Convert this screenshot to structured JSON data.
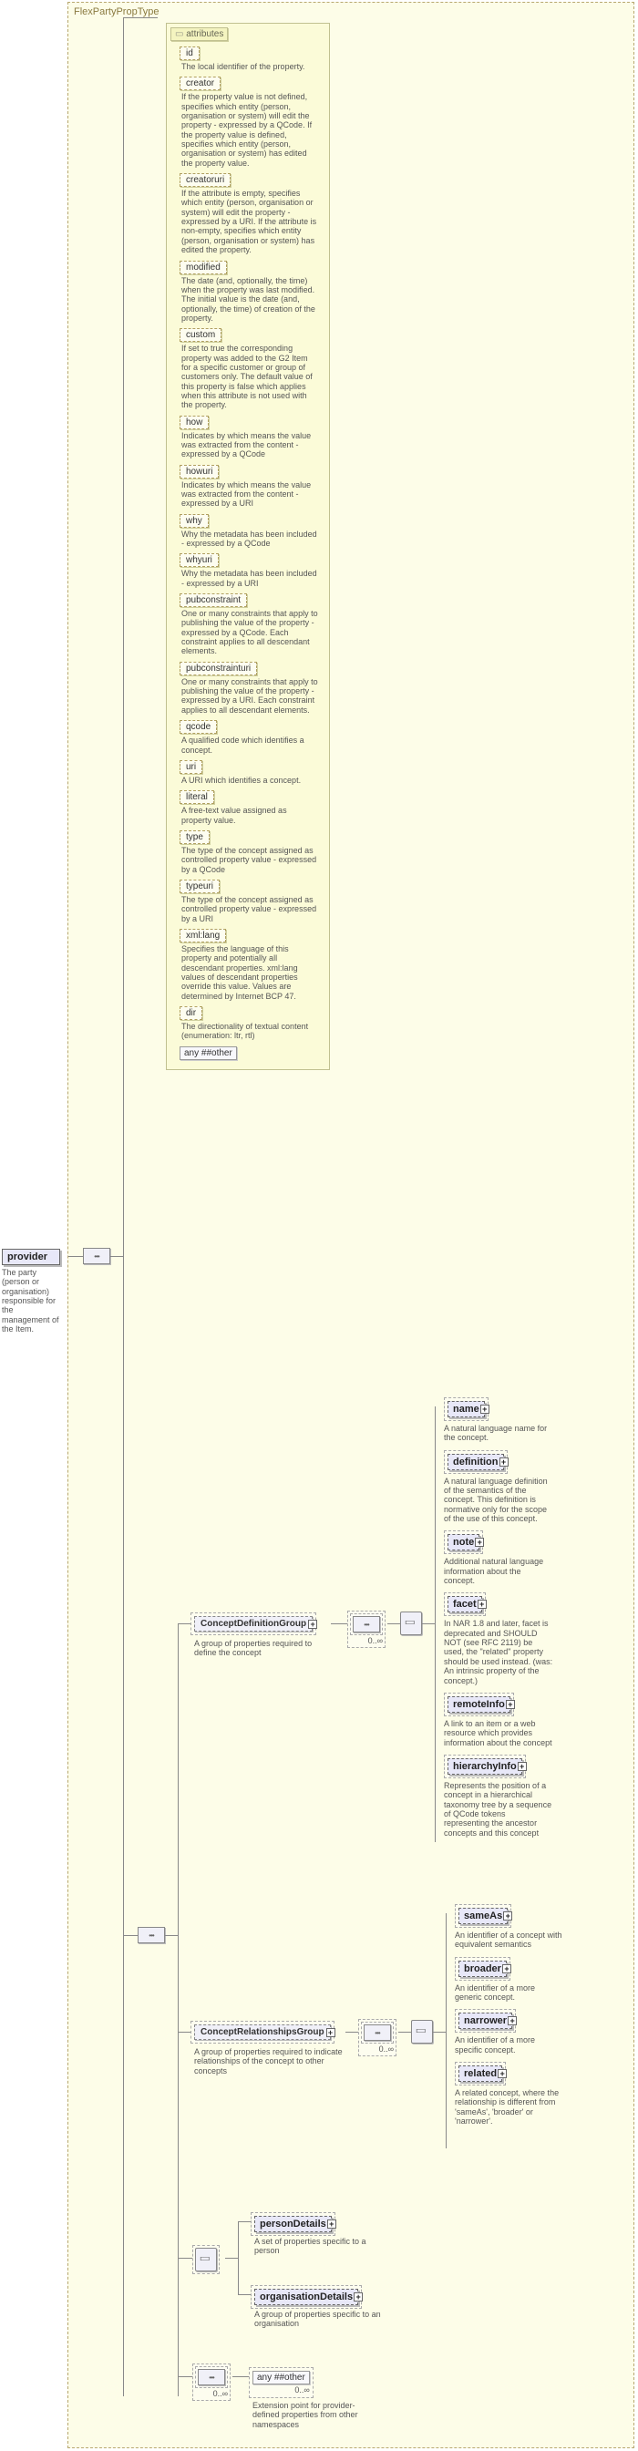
{
  "type_name": "FlexPartyPropType",
  "root": {
    "name": "provider",
    "desc": "The party (person or organisation) responsible for the management of the Item."
  },
  "attributes_label": "attributes",
  "attributes": [
    {
      "name": "id",
      "desc": "The local identifier of the property."
    },
    {
      "name": "creator",
      "desc": "If the property value is not defined, specifies which entity (person, organisation or system) will edit the property - expressed by a QCode. If the property value is defined, specifies which entity (person, organisation or system) has edited the property value."
    },
    {
      "name": "creatoruri",
      "desc": "If the attribute is empty, specifies which entity (person, organisation or system) will edit the property - expressed by a URI. If the attribute is non-empty, specifies which entity (person, organisation or system) has edited the property."
    },
    {
      "name": "modified",
      "desc": "The date (and, optionally, the time) when the property was last modified. The initial value is the date (and, optionally, the time) of creation of the property."
    },
    {
      "name": "custom",
      "desc": "If set to true the corresponding property was added to the G2 Item for a specific customer or group of customers only. The default value of this property is false which applies when this attribute is not used with the property."
    },
    {
      "name": "how",
      "desc": "Indicates by which means the value was extracted from the content - expressed by a QCode"
    },
    {
      "name": "howuri",
      "desc": "Indicates by which means the value was extracted from the content - expressed by a URI"
    },
    {
      "name": "why",
      "desc": "Why the metadata has been included - expressed by a QCode"
    },
    {
      "name": "whyuri",
      "desc": "Why the metadata has been included - expressed by a URI"
    },
    {
      "name": "pubconstraint",
      "desc": "One or many constraints that apply to publishing the value of the property - expressed by a QCode. Each constraint applies to all descendant elements."
    },
    {
      "name": "pubconstrainturi",
      "desc": "One or many constraints that apply to publishing the value of the property - expressed by a URI. Each constraint applies to all descendant elements."
    },
    {
      "name": "qcode",
      "desc": "A qualified code which identifies a concept."
    },
    {
      "name": "uri",
      "desc": "A URI which identifies a concept."
    },
    {
      "name": "literal",
      "desc": "A free-text value assigned as property value."
    },
    {
      "name": "type",
      "desc": "The type of the concept assigned as controlled property value - expressed by a QCode"
    },
    {
      "name": "typeuri",
      "desc": "The type of the concept assigned as controlled property value - expressed by a URI"
    },
    {
      "name": "xml:lang",
      "desc": "Specifies the language of this property and potentially all descendant properties. xml:lang values of descendant properties override this value. Values are determined by Internet BCP 47."
    },
    {
      "name": "dir",
      "desc": "The directionality of textual content (enumeration: ltr, rtl)"
    }
  ],
  "any_attr": "any ##other",
  "concept_def_group": {
    "name": "ConceptDefinitionGroup",
    "desc": "A group of properties required to define the concept"
  },
  "concept_def_children": [
    {
      "name": "name",
      "desc": "A natural language name for the concept."
    },
    {
      "name": "definition",
      "desc": "A natural language definition of the semantics of the concept. This definition is normative only for the scope of the use of this concept."
    },
    {
      "name": "note",
      "desc": "Additional natural language information about the concept."
    },
    {
      "name": "facet",
      "desc": "In NAR 1.8 and later, facet is deprecated and SHOULD NOT (see RFC 2119) be used, the \"related\" property should be used instead. (was: An intrinsic property of the concept.)"
    },
    {
      "name": "remoteInfo",
      "desc": "A link to an item or a web resource which provides information about the concept"
    },
    {
      "name": "hierarchyInfo",
      "desc": "Represents the position of a concept in a hierarchical taxonomy tree by a sequence of QCode tokens representing the ancestor concepts and this concept"
    }
  ],
  "concept_rel_group": {
    "name": "ConceptRelationshipsGroup",
    "desc": "A group of properties required to indicate relationships of the concept to other concepts"
  },
  "concept_rel_children": [
    {
      "name": "sameAs",
      "desc": "An identifier of a concept with equivalent semantics"
    },
    {
      "name": "broader",
      "desc": "An identifier of a more generic concept."
    },
    {
      "name": "narrower",
      "desc": "An identifier of a more specific concept."
    },
    {
      "name": "related",
      "desc": "A related concept, where the relationship is different from 'sameAs', 'broader' or 'narrower'."
    }
  ],
  "person_details": {
    "name": "personDetails",
    "desc": "A set of properties specific to a person"
  },
  "org_details": {
    "name": "organisationDetails",
    "desc": "A group of properties specific to an organisation"
  },
  "any_other": {
    "label": "any ##other",
    "desc": "Extension point for provider-defined properties from other namespaces"
  },
  "card_0_inf": "0..∞"
}
